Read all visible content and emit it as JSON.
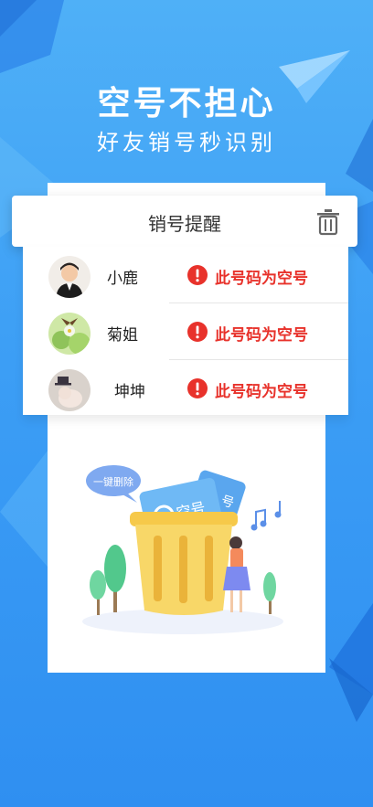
{
  "banner": {
    "title": "空号不担心",
    "subtitle": "好友销号秒识别"
  },
  "card": {
    "header_title": "销号提醒",
    "contacts": [
      {
        "name": "小鹿",
        "status": "此号码为空号"
      },
      {
        "name": "菊姐",
        "status": "此号码为空号"
      },
      {
        "name": "坤坤",
        "status": "此号码为空号"
      }
    ]
  },
  "illustration": {
    "bubble_text": "一键删除",
    "card_text": "空号",
    "card2_text": "号"
  },
  "colors": {
    "background": "#3c9ef5",
    "alert": "#e8322b",
    "bin": "#f6c94a"
  },
  "icons": [
    "paper-plane-icon",
    "trash-icon",
    "alert-icon",
    "music-note-icon"
  ]
}
